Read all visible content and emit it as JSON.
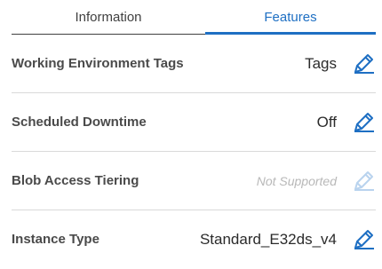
{
  "tabs": {
    "information": "Information",
    "features": "Features"
  },
  "active_tab": "features",
  "colors": {
    "accent": "#1e6fc3",
    "accent_disabled": "#b9d3ee",
    "divider": "#d9d9d9",
    "label": "#4a4a4a"
  },
  "rows": [
    {
      "label": "Working Environment Tags",
      "value": "Tags",
      "icon": "pencil-edit-icon",
      "enabled": true
    },
    {
      "label": "Scheduled Downtime",
      "value": "Off",
      "icon": "pencil-edit-icon",
      "enabled": true
    },
    {
      "label": "Blob Access Tiering",
      "value": "Not Supported",
      "icon": "pencil-edit-icon",
      "enabled": false
    },
    {
      "label": "Instance Type",
      "value": "Standard_E32ds_v4",
      "icon": "pencil-edit-icon",
      "enabled": true
    }
  ]
}
